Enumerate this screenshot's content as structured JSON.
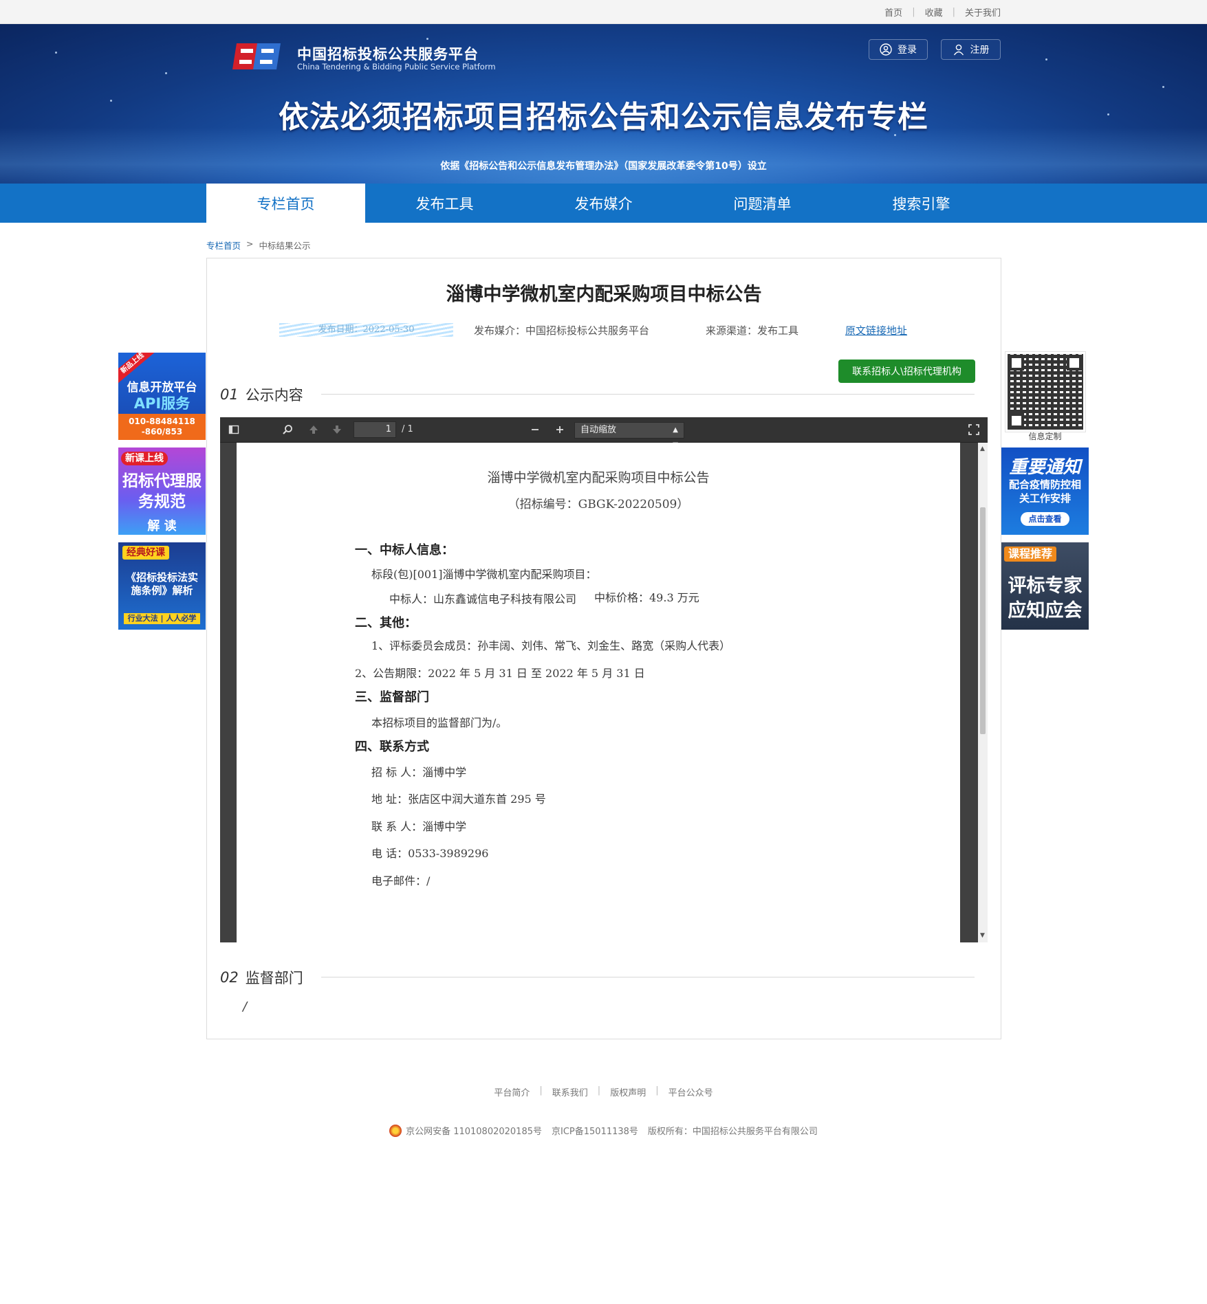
{
  "topbar": {
    "links": [
      "首页",
      "收藏",
      "关于我们"
    ]
  },
  "header": {
    "brand_cn": "中国招标投标公共服务平台",
    "brand_en": "China Tendering & Bidding Public Service Platform",
    "login_label": "登录",
    "register_label": "注册",
    "banner_title": "依法必须招标项目招标公告和公示信息发布专栏",
    "banner_subtitle": "依据《招标公告和公示信息发布管理办法》（国家发展改革委令第10号）设立"
  },
  "nav": {
    "items": [
      "专栏首页",
      "发布工具",
      "发布媒介",
      "问题清单",
      "搜索引擎"
    ],
    "active_index": 0
  },
  "breadcrumb": {
    "home": "专栏首页",
    "separator": ">",
    "current": "中标结果公示"
  },
  "notice": {
    "title": "淄博中学微机室内配采购项目中标公告",
    "publish_date": "发布日期：2022-05-30",
    "media": "发布媒介：中国招标投标公共服务平台",
    "channel": "来源渠道：发布工具",
    "source_link": "原文链接地址",
    "contact_button": "联系招标人\\招标代理机构"
  },
  "sections": {
    "s1_num": "01",
    "s1_title": "公示内容",
    "s2_num": "02",
    "s2_title": "监督部门",
    "s2_value": "/"
  },
  "viewer": {
    "page_input": "1",
    "page_count": "/ 1",
    "zoom_label": "自动缩放"
  },
  "document": {
    "title": "淄博中学微机室内配采购项目中标公告",
    "code": "（招标编号：GBGK-20220509）",
    "h1": "一、中标人信息：",
    "l1": "标段(包)[001]淄博中学微机室内配采购项目：",
    "l2": "中标人：山东鑫诚信电子科技有限公司",
    "l2b": "中标价格：49.3 万元",
    "h2": "二、其他：",
    "l3": "1、评标委员会成员：孙丰阔、刘伟、常飞、刘金生、路宽（采购人代表）",
    "l4": "2、公告期限：2022 年 5 月 31 日  至  2022 年 5 月 31 日",
    "h3": "三、监督部门",
    "l5": "本招标项目的监督部门为/。",
    "h4": "四、联系方式",
    "c1": "招  标  人：淄博中学",
    "c2": "地      址：张店区中润大道东首 295 号",
    "c3": "联  系  人：淄博中学",
    "c4": "电      话：0533-3989296",
    "c5": "电子邮件：/"
  },
  "footer": {
    "links": [
      "平台简介",
      "联系我们",
      "版权声明",
      "平台公众号"
    ],
    "security": "京公网安备 11010802020185号",
    "icp": "京ICP备15011138号",
    "copyright": "版权所有：中国招标公共服务平台有限公司"
  },
  "ads": {
    "left1_tag": "新品上线",
    "left1_title": "信息开放平台",
    "left1_sub": "API服务",
    "left1_phone": "010-88484118 -860/853",
    "left2_tag": "新课上线",
    "left2_title": "招标代理服务规范",
    "left2_sub": "解 读",
    "left3_tag": "经典好课",
    "left3_title": "《招标投标法实施条例》解析",
    "left3_sub": "行业大法 | 人人必学",
    "right_qr_label": "信息定制",
    "right2_title": "重要通知",
    "right2_sub": "配合疫情防控相关工作安排",
    "right2_btn": "点击查看",
    "right3_tag": "课程推荐",
    "right3_title": "评标专家应知应会"
  },
  "colors": {
    "nav_blue": "#1372c6",
    "contact_green": "#1e8c2a",
    "link_blue": "#1a6ab5"
  }
}
